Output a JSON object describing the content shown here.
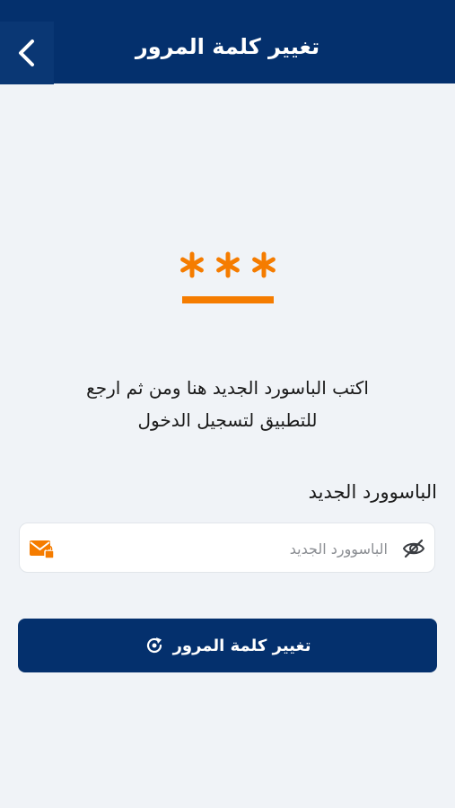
{
  "header": {
    "title": "تغيير كلمة المرور",
    "back_icon": "chevron-left-icon"
  },
  "hero": {
    "icon": "password-asterisks-icon",
    "color": "#f57c00"
  },
  "instructions": {
    "line1": "اكتب الباسورد الجديد هنا ومن ثم ارجع",
    "line2": "للتطبيق لتسجيل الدخول"
  },
  "password_field": {
    "label": "الباسوورد الجديد",
    "placeholder": "الباسوورد الجديد",
    "value": "",
    "visibility_icon": "eye-off-icon",
    "mail_icon": "mail-lock-icon"
  },
  "submit_button": {
    "label": "تغيير كلمة المرور",
    "icon": "refresh-icon"
  },
  "colors": {
    "primary": "#04306d",
    "accent": "#f57c00",
    "background": "#f0f3f7"
  }
}
